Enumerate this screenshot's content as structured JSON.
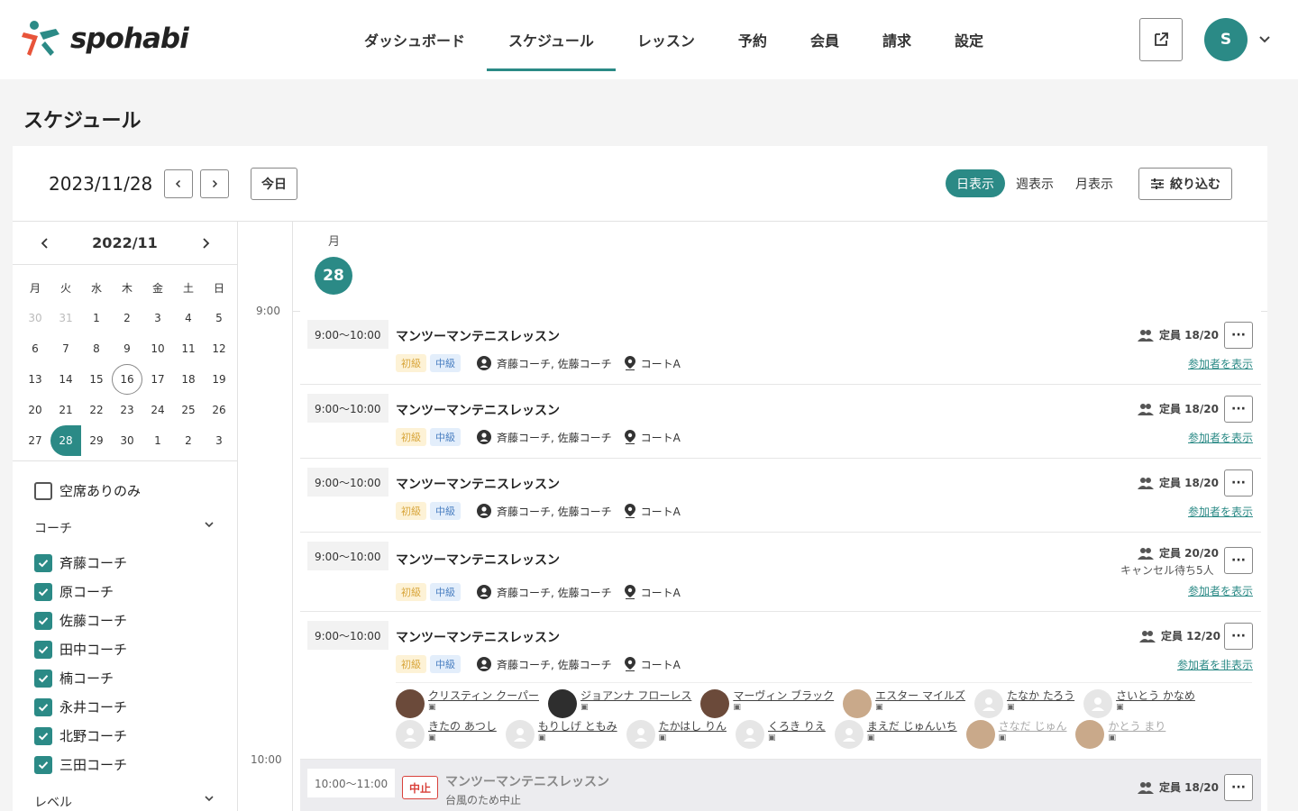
{
  "brand": {
    "name": "spohabi",
    "accent": "#2b8a86"
  },
  "nav": [
    {
      "label": "ダッシュボード",
      "active": false
    },
    {
      "label": "スケジュール",
      "active": true
    },
    {
      "label": "レッスン",
      "active": false
    },
    {
      "label": "予約",
      "active": false
    },
    {
      "label": "会員",
      "active": false
    },
    {
      "label": "請求",
      "active": false
    },
    {
      "label": "設定",
      "active": false
    }
  ],
  "user": {
    "initial": "S"
  },
  "page": {
    "title": "スケジュール"
  },
  "toolbar": {
    "date": "2023/11/28",
    "today": "今日",
    "views": [
      "日表示",
      "週表示",
      "月表示"
    ],
    "filter": "絞り込む"
  },
  "mini_calendar": {
    "month": "2022/11",
    "weekdays": [
      "月",
      "火",
      "水",
      "木",
      "金",
      "土",
      "日"
    ],
    "weeks": [
      [
        "30",
        "31",
        "1",
        "2",
        "3",
        "4",
        "5"
      ],
      [
        "6",
        "7",
        "8",
        "9",
        "10",
        "11",
        "12"
      ],
      [
        "13",
        "14",
        "15",
        "16",
        "17",
        "18",
        "19"
      ],
      [
        "20",
        "21",
        "22",
        "23",
        "24",
        "25",
        "26"
      ],
      [
        "27",
        "28",
        "29",
        "30",
        "1",
        "2",
        "3"
      ]
    ],
    "muted": [
      "30",
      "31"
    ],
    "today": "16",
    "selected": "28"
  },
  "filters": {
    "vacancy_only": "空席ありのみ",
    "coach_heading": "コーチ",
    "coaches": [
      "斉藤コーチ",
      "原コーチ",
      "佐藤コーチ",
      "田中コーチ",
      "楠コーチ",
      "永井コーチ",
      "北野コーチ",
      "三田コーチ"
    ],
    "level_heading": "レベル"
  },
  "day": {
    "weekday": "月",
    "date": "28"
  },
  "hours": [
    "9:00",
    "10:00"
  ],
  "events": [
    {
      "time": "9:00〜10:00",
      "title": "マンツーマンテニスレッスン",
      "tags": [
        "初級",
        "中級"
      ],
      "coaches": "斉藤コーチ, 佐藤コーチ",
      "court": "コートA",
      "capacity": "定員 18/20",
      "link": "参加者を表示"
    },
    {
      "time": "9:00〜10:00",
      "title": "マンツーマンテニスレッスン",
      "tags": [
        "初級",
        "中級"
      ],
      "coaches": "斉藤コーチ, 佐藤コーチ",
      "court": "コートA",
      "capacity": "定員 18/20",
      "link": "参加者を表示"
    },
    {
      "time": "9:00〜10:00",
      "title": "マンツーマンテニスレッスン",
      "tags": [
        "初級",
        "中級"
      ],
      "coaches": "斉藤コーチ, 佐藤コーチ",
      "court": "コートA",
      "capacity": "定員 18/20",
      "link": "参加者を表示"
    },
    {
      "time": "9:00〜10:00",
      "title": "マンツーマンテニスレッスン",
      "tags": [
        "初級",
        "中級"
      ],
      "coaches": "斉藤コーチ, 佐藤コーチ",
      "court": "コートA",
      "capacity": "定員 20/20",
      "waitlist": "キャンセル待ち5人",
      "link": "参加者を表示"
    },
    {
      "time": "9:00〜10:00",
      "title": "マンツーマンテニスレッスン",
      "tags": [
        "初級",
        "中級"
      ],
      "coaches": "斉藤コーチ, 佐藤コーチ",
      "court": "コートA",
      "capacity": "定員 12/20",
      "link": "参加者を非表示"
    }
  ],
  "participants_row1": [
    {
      "name": "クリスティン クーパー",
      "avatar": "photo"
    },
    {
      "name": "ジョアンナ フローレス",
      "avatar": "dark"
    },
    {
      "name": "マーヴィン ブラック",
      "avatar": "photo"
    },
    {
      "name": "エスター マイルズ",
      "avatar": "warm"
    },
    {
      "name": "たなか たろう",
      "avatar": "blank"
    },
    {
      "name": "さいとう かなめ",
      "avatar": "blank"
    }
  ],
  "participants_row2": [
    {
      "name": "きたの あつし",
      "avatar": "blank"
    },
    {
      "name": "もりしげ ともみ",
      "avatar": "blank"
    },
    {
      "name": "たかはし りん",
      "avatar": "blank"
    },
    {
      "name": "くろき りえ",
      "avatar": "blank"
    },
    {
      "name": "まえだ じゅんいち",
      "avatar": "blank"
    },
    {
      "name": "さなだ じゅん",
      "avatar": "warm"
    },
    {
      "name": "かとう まり",
      "avatar": "warm"
    }
  ],
  "cancelled_event": {
    "time": "10:00〜11:00",
    "badge": "中止",
    "title": "マンツーマンテニスレッスン",
    "reason": "台風のため中止",
    "capacity": "定員 18/20"
  }
}
